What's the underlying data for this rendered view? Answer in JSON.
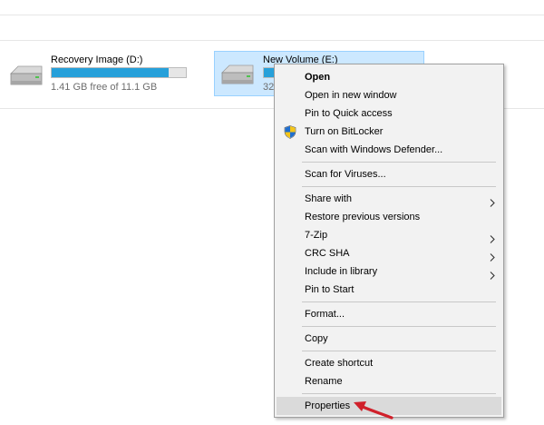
{
  "drives": [
    {
      "name": "Recovery Image (D:)",
      "free_text": "1.41 GB free of 11.1 GB",
      "used_fraction": 0.873
    },
    {
      "name": "New Volume (E:)",
      "free_text": "327",
      "used_fraction": 0.12
    }
  ],
  "context_menu": {
    "items": {
      "open": "Open",
      "open_new_window": "Open in new window",
      "pin_quick_access": "Pin to Quick access",
      "bitlocker": "Turn on BitLocker",
      "defender": "Scan with Windows Defender...",
      "scan_viruses": "Scan for Viruses...",
      "share_with": "Share with",
      "restore_versions": "Restore previous versions",
      "seven_zip": "7-Zip",
      "crc_sha": "CRC SHA",
      "include_library": "Include in library",
      "pin_start": "Pin to Start",
      "format": "Format...",
      "copy": "Copy",
      "create_shortcut": "Create shortcut",
      "rename": "Rename",
      "properties": "Properties"
    }
  },
  "colors": {
    "selection_bg": "#cce8ff",
    "selection_border": "#99d1ff",
    "drive_bar_fill": "#26a0da",
    "menu_bg": "#f2f2f2",
    "menu_highlight": "#dadada",
    "annotation_arrow": "#d0202a"
  },
  "icons": {
    "drive": "hard-drive-icon",
    "shield": "uac-shield-icon",
    "submenu": "chevron-right-icon",
    "annotation": "red-arrow-pointer"
  }
}
